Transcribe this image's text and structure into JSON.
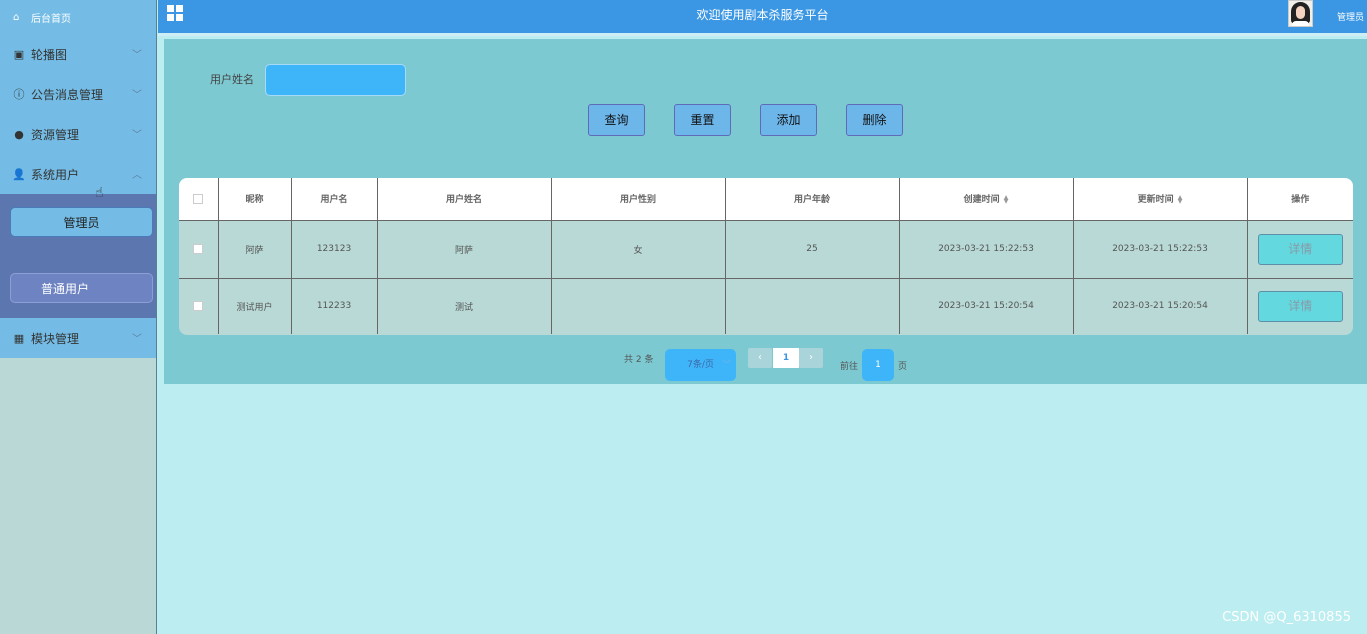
{
  "header": {
    "title": "欢迎使用剧本杀服务平台",
    "user_label": "管理员"
  },
  "sidebar": {
    "home": "后台首页",
    "items": [
      {
        "label": "轮播图",
        "icon": "image-icon",
        "expanded": false
      },
      {
        "label": "公告消息管理",
        "icon": "info-icon",
        "expanded": false
      },
      {
        "label": "资源管理",
        "icon": "location-icon",
        "expanded": false
      },
      {
        "label": "系统用户",
        "icon": "user-icon",
        "expanded": true
      },
      {
        "label": "模块管理",
        "icon": "grid-icon",
        "expanded": false
      }
    ],
    "sub_items": [
      {
        "label": "管理员",
        "active": true
      },
      {
        "label": "普通用户",
        "active": false
      }
    ]
  },
  "search": {
    "label": "用户姓名",
    "value": "",
    "placeholder": ""
  },
  "actions": {
    "query": "查询",
    "reset": "重置",
    "add": "添加",
    "delete": "删除"
  },
  "table": {
    "columns": [
      "昵称",
      "用户名",
      "用户姓名",
      "用户性别",
      "用户年龄",
      "创建时间",
      "更新时间",
      "操作"
    ],
    "rows": [
      {
        "nickname": "阿萨",
        "username": "123123",
        "name": "阿萨",
        "gender": "女",
        "age": "25",
        "created": "2023-03-21 15:22:53",
        "updated": "2023-03-21 15:22:53",
        "action": "详情"
      },
      {
        "nickname": "测试用户",
        "username": "112233",
        "name": "测试",
        "gender": "",
        "age": "",
        "created": "2023-03-21 15:20:54",
        "updated": "2023-03-21 15:20:54",
        "action": "详情"
      }
    ]
  },
  "pagination": {
    "total": "共 2 条",
    "page_size": "7条/页",
    "current": "1",
    "goto_label": "前往",
    "goto_value": "1",
    "page_suffix": "页"
  },
  "watermark": "CSDN @Q_6310855",
  "colors": {
    "header": "#3b97e3",
    "sidebar": "#74bce5",
    "submenu": "#5c76b0",
    "content": "#7cc9d1",
    "page_bg": "#bcedf0"
  }
}
